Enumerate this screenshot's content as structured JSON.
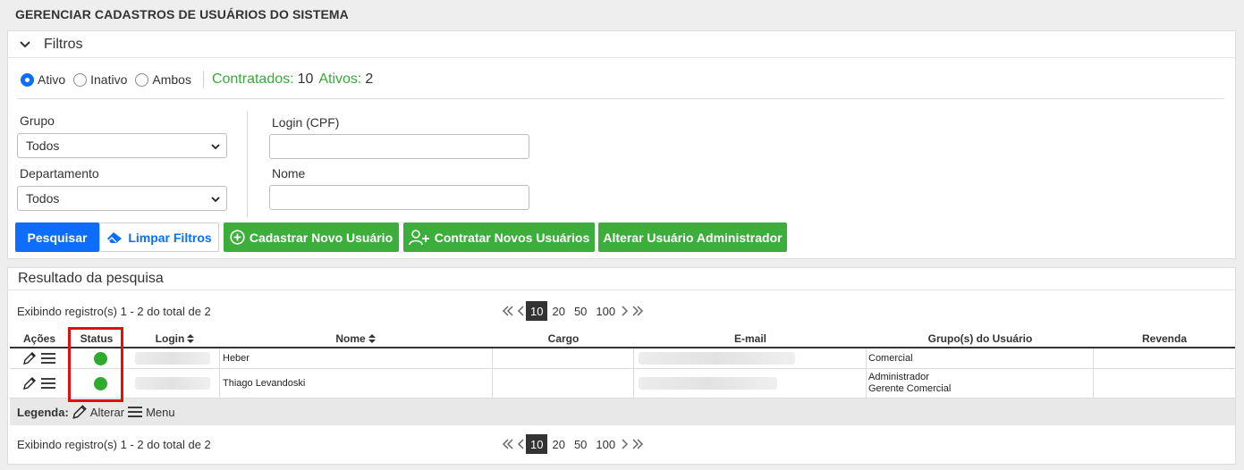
{
  "page": {
    "title": "GERENCIAR CADASTROS DE USUÁRIOS DO SISTEMA"
  },
  "filters": {
    "header_title": "Filtros",
    "radios": [
      {
        "label": "Ativo",
        "checked": true
      },
      {
        "label": "Inativo",
        "checked": false
      },
      {
        "label": "Ambos",
        "checked": false
      }
    ],
    "stats": {
      "contratados_label": "Contratados:",
      "contratados_value": "10",
      "ativos_label": "Ativos:",
      "ativos_value": "2"
    },
    "grupo_label": "Grupo",
    "grupo_value": "Todos",
    "departamento_label": "Departamento",
    "departamento_value": "Todos",
    "login_label": "Login (CPF)",
    "login_value": "",
    "nome_label": "Nome",
    "nome_value": ""
  },
  "buttons": {
    "pesquisar": "Pesquisar",
    "limpar": "Limpar Filtros",
    "cadastrar": "Cadastrar Novo Usuário",
    "contratar": "Contratar Novos Usuários",
    "alterar_admin": "Alterar Usuário Administrador"
  },
  "results": {
    "header_title": "Resultado da pesquisa",
    "showing_text": "Exibindo registro(s) 1 - 2 do total de 2",
    "page_sizes": [
      "10",
      "20",
      "50",
      "100"
    ],
    "active_page_size": "10",
    "columns": {
      "acoes": "Ações",
      "status": "Status",
      "login": "Login",
      "nome": "Nome",
      "cargo": "Cargo",
      "email": "E-mail",
      "grupos": "Grupo(s) do Usuário",
      "revenda": "Revenda"
    },
    "rows": [
      {
        "nome": "Heber",
        "cargo": "",
        "grupo_1": "Comercial",
        "grupo_2": "",
        "revenda": "",
        "status": "active"
      },
      {
        "nome": "Thiago Levandoski",
        "cargo": "",
        "grupo_1": "Administrador",
        "grupo_2": "Gerente Comercial",
        "revenda": "",
        "status": "active"
      }
    ],
    "legend": {
      "title": "Legenda:",
      "alterar": "Alterar",
      "menu": "Menu"
    }
  },
  "colors": {
    "primary": "#0d6efd",
    "success": "#3bae3b",
    "status_active": "#2eaa2e",
    "highlight": "#e01010"
  }
}
